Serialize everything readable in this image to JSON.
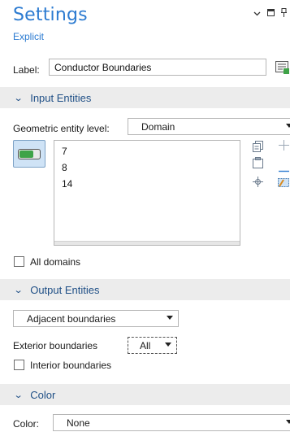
{
  "header": {
    "title": "Settings",
    "subtitle": "Explicit",
    "icons": [
      "chevron-down-icon",
      "maximize-icon",
      "pin-icon"
    ]
  },
  "label_row": {
    "label": "Label:",
    "value": "Conductor Boundaries"
  },
  "input_entities": {
    "section_title": "Input Entities",
    "geometric_level_label": "Geometric entity level:",
    "geometric_level_value": "Domain",
    "selection": [
      "7",
      "8",
      "14"
    ],
    "all_domains_label": "All domains",
    "all_domains_checked": false
  },
  "output_entities": {
    "section_title": "Output Entities",
    "output_type": "Adjacent boundaries",
    "exterior_label": "Exterior boundaries",
    "exterior_value": "All",
    "interior_label": "Interior boundaries",
    "interior_checked": false
  },
  "color": {
    "section_title": "Color",
    "color_label": "Color:",
    "color_value": "None"
  }
}
